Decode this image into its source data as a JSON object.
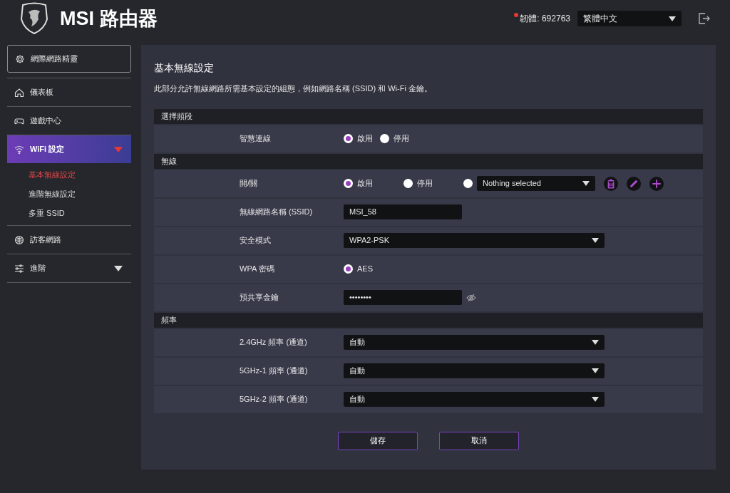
{
  "header": {
    "title": "MSI 路由器",
    "firmware": "韌體: 692763",
    "language": "繁體中文"
  },
  "sidebar": {
    "items": [
      {
        "kind": "wizard",
        "label": "網際網路精靈",
        "selected": false
      },
      {
        "kind": "item",
        "label": "儀表板",
        "selected": false
      },
      {
        "kind": "item",
        "label": "遊戲中心",
        "selected": false
      },
      {
        "kind": "group",
        "label": "WiFi 設定",
        "selected": true,
        "expanded": true,
        "children": [
          {
            "label": "基本無線設定",
            "selected": true
          },
          {
            "label": "進階無線設定",
            "selected": false
          },
          {
            "label": "多重 SSID",
            "selected": false
          }
        ]
      },
      {
        "kind": "item",
        "label": "訪客網路",
        "selected": false
      },
      {
        "kind": "group",
        "label": "進階",
        "selected": false,
        "expanded": false
      }
    ]
  },
  "page": {
    "title": "基本無線設定",
    "description": "此部分允許無線網路所需基本設定的組態，例如網路名稱 (SSID) 和 Wi-Fi 金鑰。",
    "sections": [
      {
        "title": "選擇頻段",
        "rows": [
          {
            "kind": "radio",
            "label": "智慧連線",
            "options": [
              {
                "label": "啟用",
                "selected": true
              },
              {
                "label": "停用",
                "selected": false
              }
            ]
          }
        ]
      },
      {
        "title": "無線",
        "rows": [
          {
            "kind": "radio_profile",
            "label": "開/關",
            "options": [
              {
                "label": "啟用",
                "selected": true
              },
              {
                "label": "停用",
                "selected": false
              }
            ],
            "profile": {
              "selected": false,
              "value": "Nothing selected"
            },
            "actions": [
              {
                "kind": "delete"
              },
              {
                "kind": "edit"
              },
              {
                "kind": "add"
              }
            ]
          },
          {
            "kind": "text",
            "label": "無線網路名稱 (SSID)",
            "value": "MSI_58"
          },
          {
            "kind": "select",
            "label": "安全模式",
            "value": "WPA2-PSK"
          },
          {
            "kind": "radio",
            "label": "WPA 密碼",
            "options": [
              {
                "label": "AES",
                "selected": true
              }
            ]
          },
          {
            "kind": "password",
            "label": "預共享金鑰",
            "value": "••••••••"
          }
        ]
      },
      {
        "title": "頻率",
        "rows": [
          {
            "kind": "select",
            "label": "2.4GHz 頻率 (通道)",
            "value": "自動"
          },
          {
            "kind": "select",
            "label": "5GHz-1 頻率 (通道)",
            "value": "自動"
          },
          {
            "kind": "select",
            "label": "5GHz-2 頻率 (通道)",
            "value": "自動"
          }
        ]
      }
    ],
    "buttons": [
      "儲存",
      "取消"
    ]
  }
}
